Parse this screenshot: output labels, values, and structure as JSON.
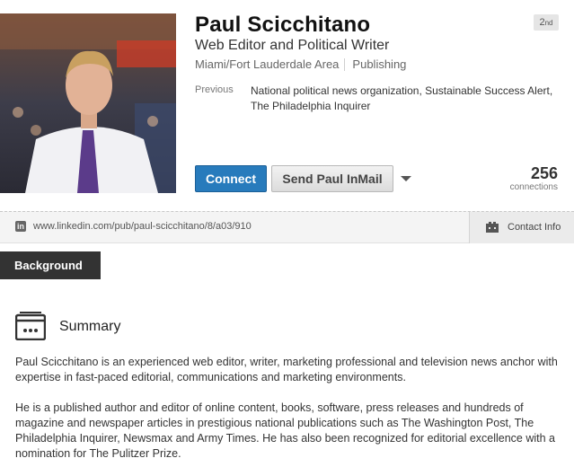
{
  "profile": {
    "name": "Paul Scicchitano",
    "degree_num": "2",
    "degree_suffix": "nd",
    "headline": "Web Editor and Political Writer",
    "location": "Miami/Fort Lauderdale Area",
    "industry": "Publishing",
    "previous_label": "Previous",
    "previous_value": "National political news organization, Sustainable Success Alert, The Philadelphia Inquirer"
  },
  "actions": {
    "connect_label": "Connect",
    "inmail_label": "Send Paul InMail",
    "connections_count": "256",
    "connections_label": "connections"
  },
  "url_bar": {
    "url": "www.linkedin.com/pub/paul-scicchitano/8/a03/910",
    "contact_label": "Contact Info"
  },
  "background": {
    "tab_label": "Background",
    "summary_title": "Summary",
    "paragraphs": [
      "Paul Scicchitano is an experienced web editor, writer, marketing professional and television news anchor with expertise in fast-paced editorial, communications and marketing environments.",
      "He is a published author and editor of online content, books, software, press releases and hundreds of magazine and newspaper articles in prestigious national publications such as The Washington Post, The Philadelphia Inquirer, Newsmax and Army Times. He has also been recognized for editorial excellence with a nomination for The Pulitzer Prize."
    ]
  },
  "colors": {
    "connect_blue": "#287bbc",
    "tab_dark": "#333333"
  }
}
